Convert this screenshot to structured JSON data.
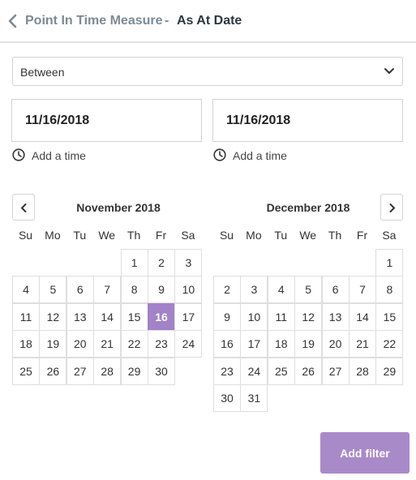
{
  "header": {
    "parent_label": "Point In Time Measure",
    "separator": "-",
    "current_label": "As At Date"
  },
  "operator_select": {
    "value": "Between"
  },
  "date_start": {
    "value": "11/16/2018"
  },
  "date_end": {
    "value": "11/16/2018"
  },
  "add_time_start": {
    "label": "Add a time"
  },
  "add_time_end": {
    "label": "Add a time"
  },
  "weekdays": [
    "Su",
    "Mo",
    "Tu",
    "We",
    "Th",
    "Fr",
    "Sa"
  ],
  "calendars": [
    {
      "title": "November 2018",
      "first_weekday": 4,
      "days": 30,
      "selected_day": 16
    },
    {
      "title": "December 2018",
      "first_weekday": 6,
      "days": 31,
      "selected_day": null
    }
  ],
  "colors": {
    "accent": "#a282c8",
    "button": "#a98ac9"
  },
  "footer": {
    "add_filter_label": "Add filter"
  }
}
